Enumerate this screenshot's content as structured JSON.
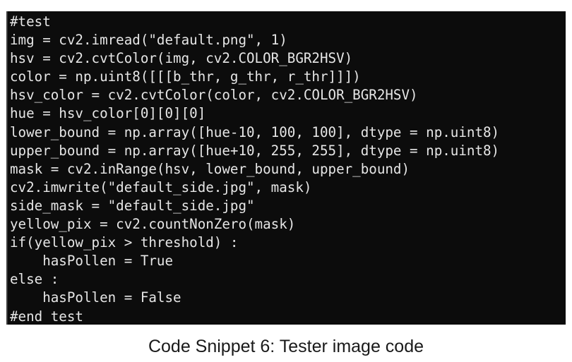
{
  "code": {
    "lines": [
      "#test",
      "img = cv2.imread(\"default.png\", 1)",
      "hsv = cv2.cvtColor(img, cv2.COLOR_BGR2HSV)",
      "color = np.uint8([[[b_thr, g_thr, r_thr]]])",
      "hsv_color = cv2.cvtColor(color, cv2.COLOR_BGR2HSV)",
      "hue = hsv_color[0][0][0]",
      "lower_bound = np.array([hue-10, 100, 100], dtype = np.uint8)",
      "upper_bound = np.array([hue+10, 255, 255], dtype = np.uint8)",
      "mask = cv2.inRange(hsv, lower_bound, upper_bound)",
      "cv2.imwrite(\"default_side.jpg\", mask)",
      "side_mask = \"default_side.jpg\"",
      "yellow_pix = cv2.countNonZero(mask)",
      "if(yellow_pix > threshold) :",
      "    hasPollen = True",
      "else :",
      "    hasPollen = False",
      "#end test"
    ]
  },
  "caption": "Code Snippet 6: Tester image code",
  "colors": {
    "code_background": "#0c0c0c",
    "code_text": "#e6e6e6",
    "page_background": "#ffffff"
  }
}
